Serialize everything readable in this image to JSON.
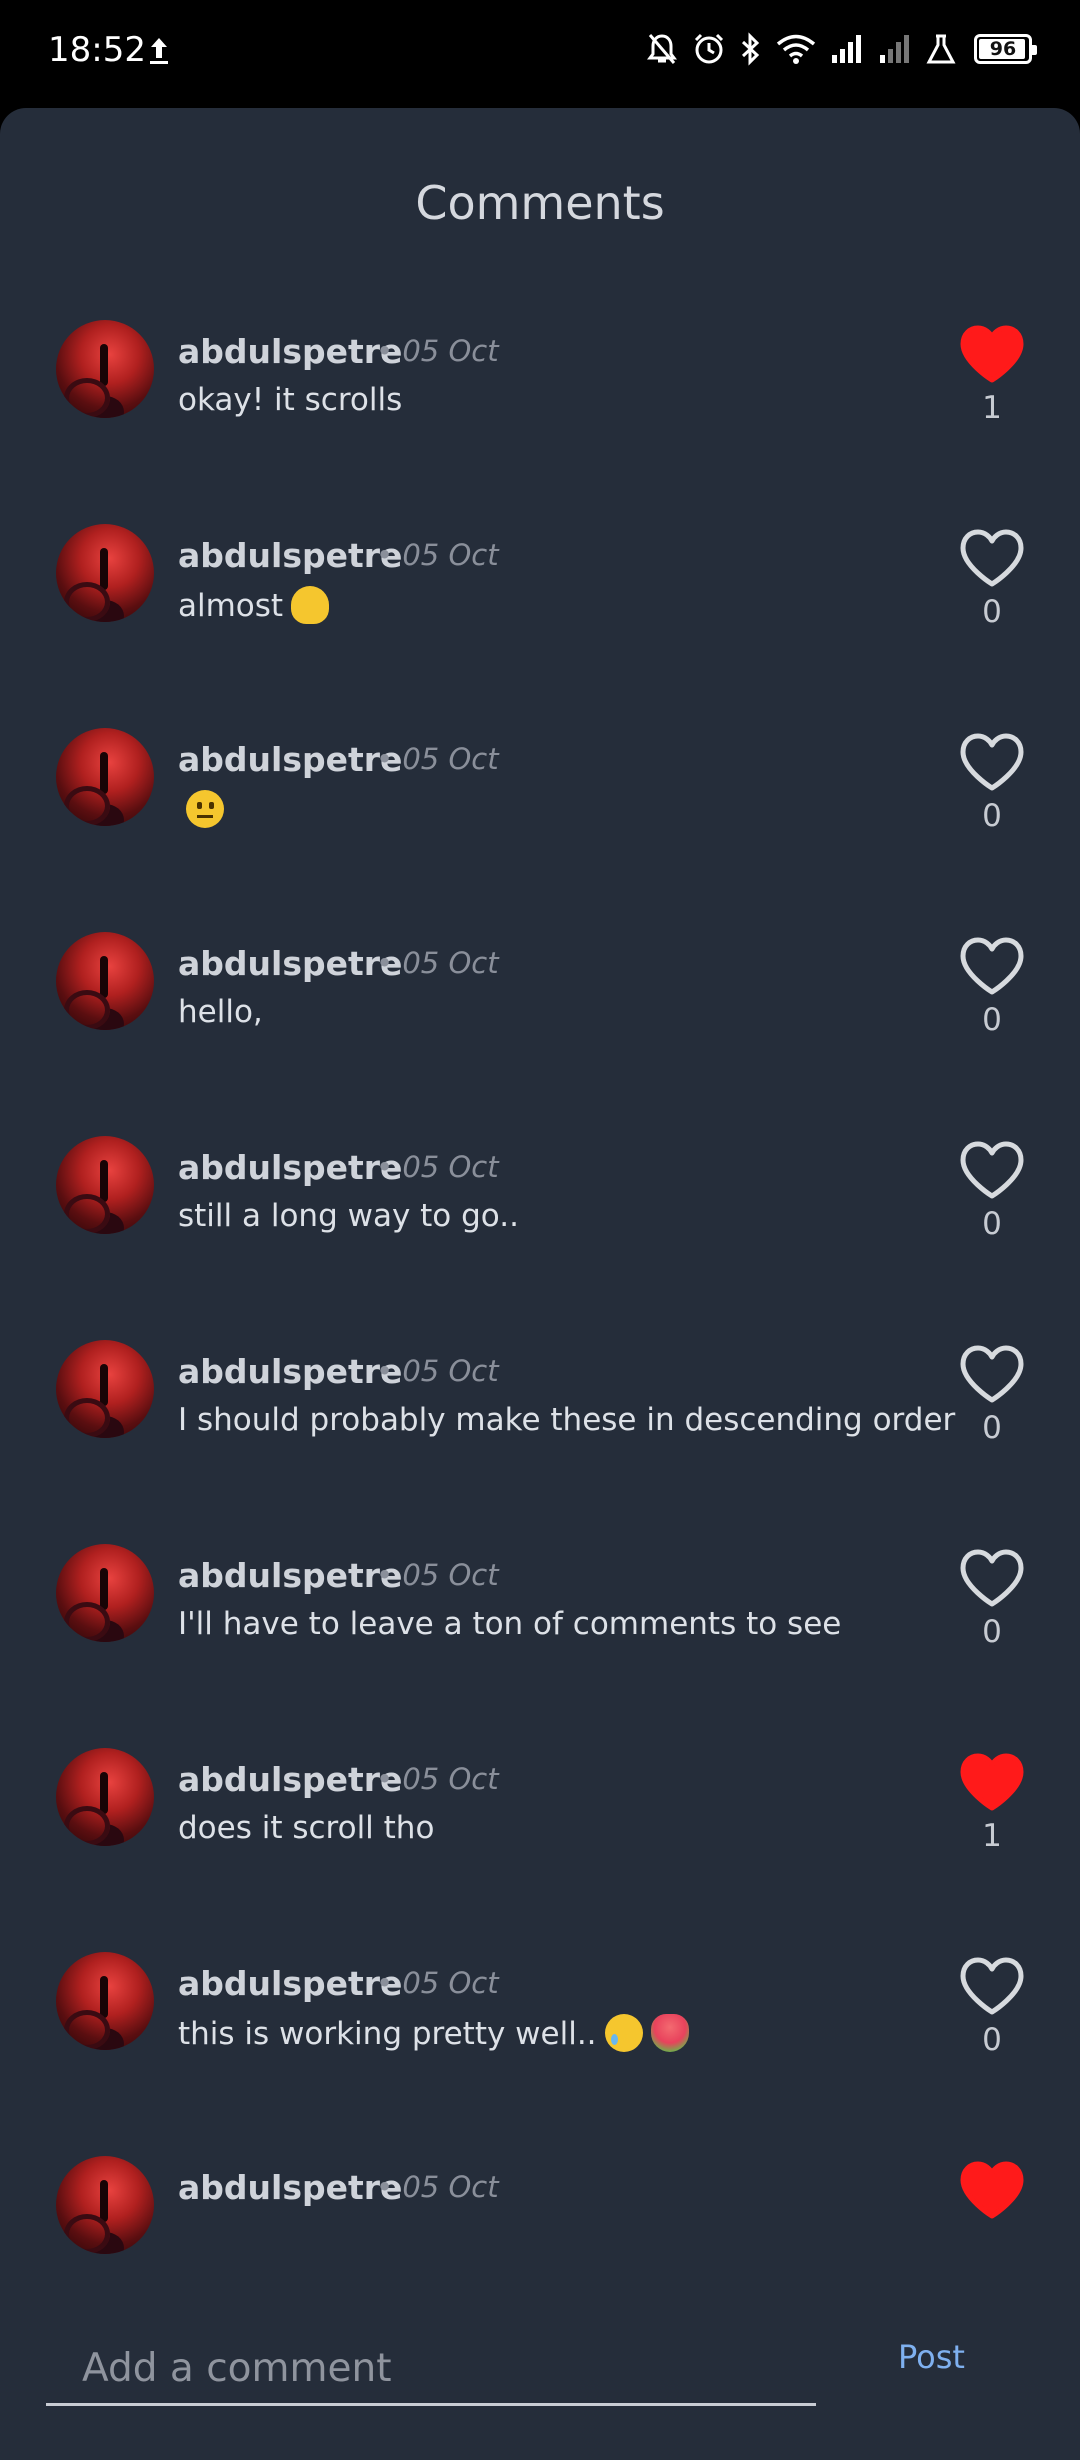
{
  "status_bar": {
    "time": "18:52",
    "battery": "96",
    "battery_level": 0.96
  },
  "sheet": {
    "title": "Comments"
  },
  "colors": {
    "background": "#252d3a",
    "like_active": "#ff1a1a",
    "link_accent": "#7fb0ef"
  },
  "comments": [
    {
      "username": "abdulspetre",
      "date": "• 05 Oct",
      "text": "okay! it scrolls",
      "emoji": "",
      "likes": "1",
      "liked": true
    },
    {
      "username": "abdulspetre",
      "date": "• 05 Oct",
      "text": "almost",
      "emoji": "melting-face",
      "likes": "0",
      "liked": false
    },
    {
      "username": "abdulspetre",
      "date": "• 05 Oct",
      "text": "",
      "emoji": "neutral-face",
      "likes": "0",
      "liked": false
    },
    {
      "username": "abdulspetre",
      "date": "• 05 Oct",
      "text": "hello,",
      "emoji": "",
      "likes": "0",
      "liked": false
    },
    {
      "username": "abdulspetre",
      "date": "• 05 Oct",
      "text": "still a long way to go..",
      "emoji": "",
      "likes": "0",
      "liked": false
    },
    {
      "username": "abdulspetre",
      "date": "• 05 Oct",
      "text": "I should probably make these in descending order",
      "emoji": "",
      "likes": "0",
      "liked": false
    },
    {
      "username": "abdulspetre",
      "date": "• 05 Oct",
      "text": "I'll have to leave a ton of comments to see",
      "emoji": "",
      "likes": "0",
      "liked": false
    },
    {
      "username": "abdulspetre",
      "date": "• 05 Oct",
      "text": "does it scroll tho",
      "emoji": "",
      "likes": "1",
      "liked": true
    },
    {
      "username": "abdulspetre",
      "date": "• 05 Oct",
      "text": "this is working pretty well..",
      "emoji": "holding-back-tears-face, bouquet",
      "likes": "0",
      "liked": false
    },
    {
      "username": "abdulspetre",
      "date": "• 05 Oct",
      "text": "",
      "emoji": "",
      "likes": "",
      "liked": true
    }
  ],
  "composer": {
    "placeholder": "Add a comment",
    "value": "",
    "post_label": "Post"
  }
}
